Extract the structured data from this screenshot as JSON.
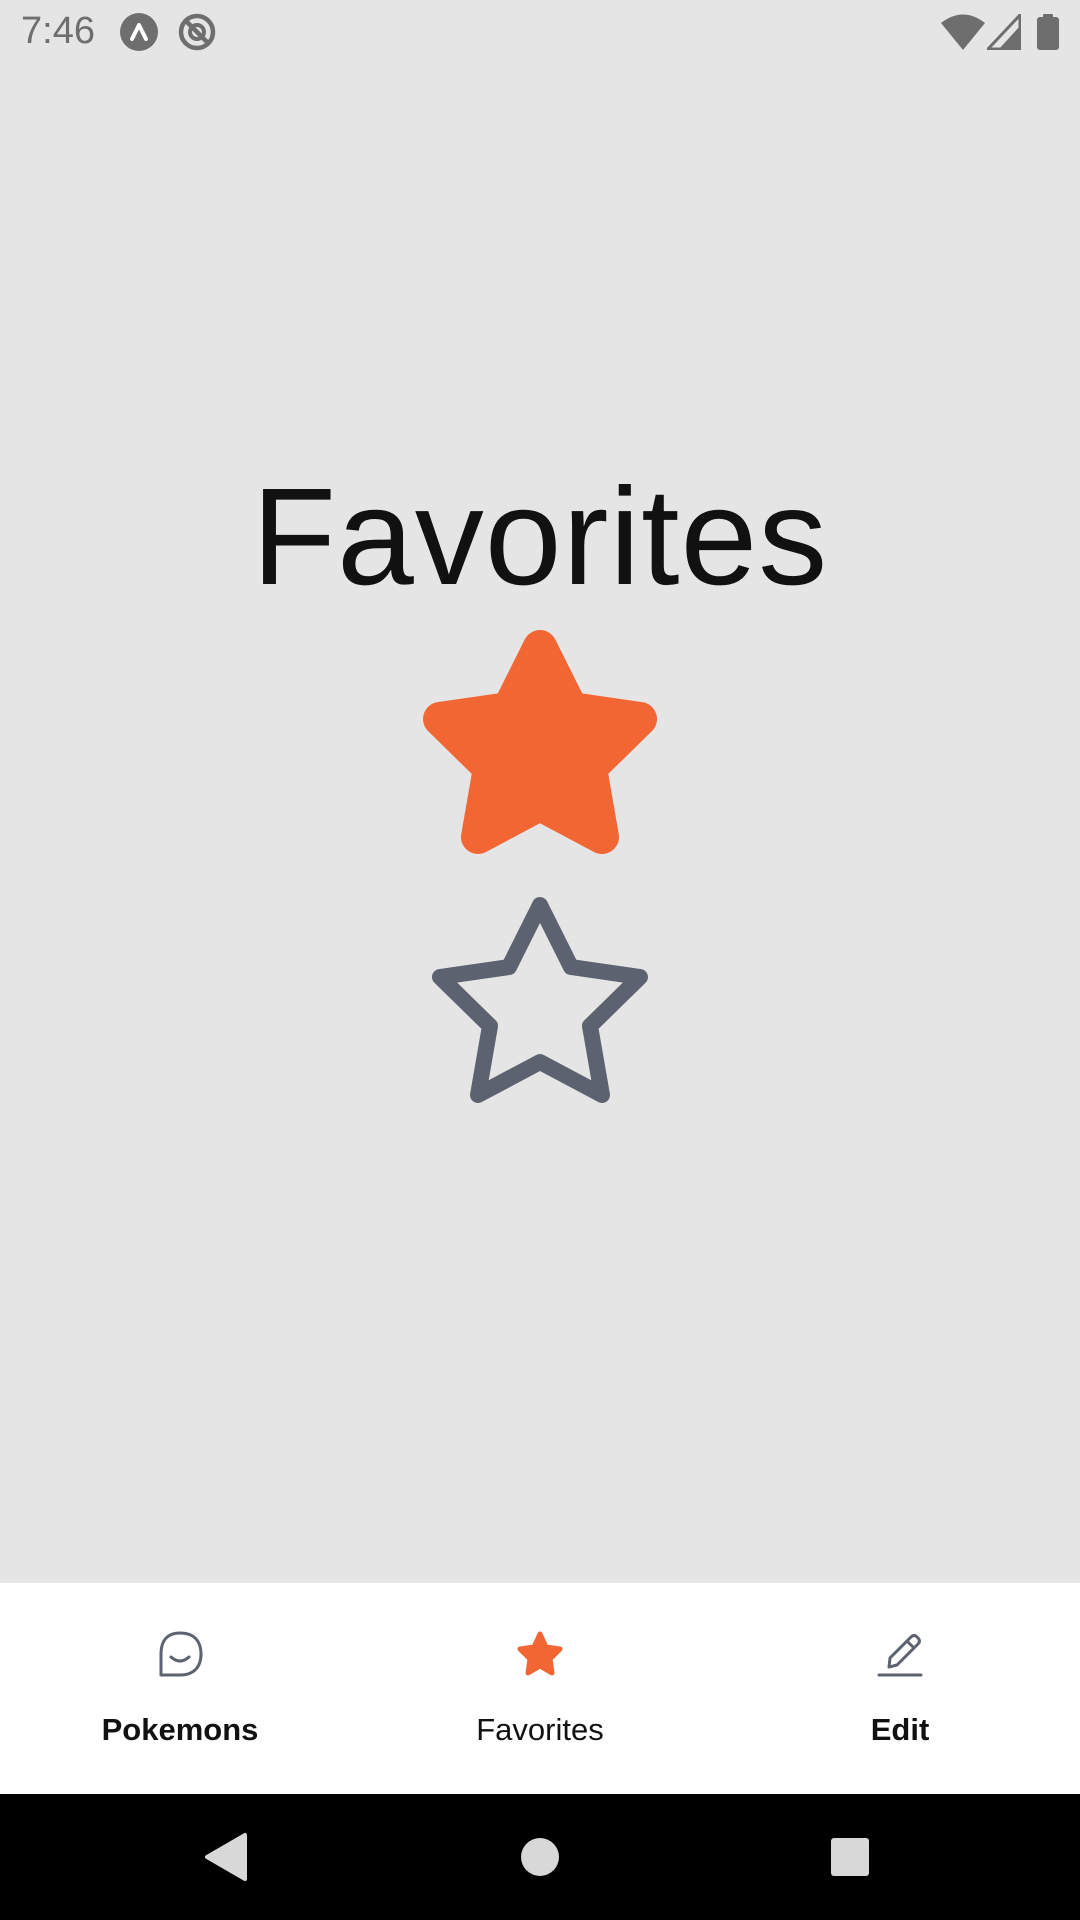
{
  "status_bar": {
    "time": "7:46",
    "icons": [
      "app-notification-icon",
      "sync-notification-icon",
      "wifi-icon",
      "signal-icon",
      "battery-icon"
    ]
  },
  "main": {
    "title": "Favorites",
    "stars": [
      {
        "icon": "star-filled-icon",
        "color": "#f26633"
      },
      {
        "icon": "star-outline-icon",
        "color": "#5c6270"
      }
    ]
  },
  "bottom_nav": {
    "items": [
      {
        "label": "Pokemons",
        "icon": "smile-face-icon",
        "selected": false
      },
      {
        "label": "Favorites",
        "icon": "star-icon",
        "selected": true
      },
      {
        "label": "Edit",
        "icon": "pencil-icon",
        "selected": false
      }
    ]
  },
  "system_nav": {
    "buttons": [
      "back-icon",
      "home-icon",
      "recents-icon"
    ]
  },
  "colors": {
    "accent": "#f26633",
    "background": "#e5e5e5",
    "outline_gray": "#5c6270"
  }
}
